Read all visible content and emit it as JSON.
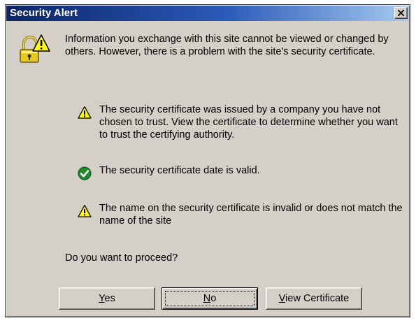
{
  "window": {
    "title": "Security Alert",
    "close_label": "x"
  },
  "icons": {
    "lock": "lock-warning-icon",
    "warning": "warning-icon",
    "check": "check-icon"
  },
  "colors": {
    "title_bar_start": "#0a246a",
    "title_bar_end": "#a6caf0",
    "face": "#d4d0c8",
    "warning_fill": "#ffff00",
    "check_fill": "#1f8a2c"
  },
  "content": {
    "intro": "Information you exchange with this site cannot be viewed or changed by others. However, there is a problem with the site's security certificate.",
    "messages": [
      {
        "icon": "warning",
        "text": "The security certificate was issued by a company you have not chosen to trust. View the certificate to determine whether you want to trust the certifying authority."
      },
      {
        "icon": "check",
        "text": "The security certificate date is valid."
      },
      {
        "icon": "warning",
        "text": "The name on the security certificate is invalid or does not match the name of the site"
      }
    ],
    "question": "Do you want to proceed?"
  },
  "buttons": {
    "yes": {
      "mnemonic": "Y",
      "rest": "es"
    },
    "no": {
      "mnemonic": "N",
      "rest": "o"
    },
    "view_certificate": {
      "mnemonic": "V",
      "rest": "iew Certificate"
    }
  }
}
